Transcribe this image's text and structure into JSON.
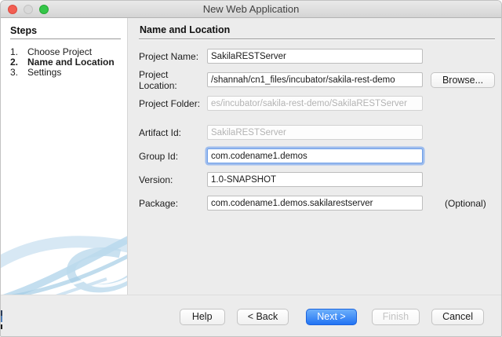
{
  "window": {
    "title": "New Web Application"
  },
  "steps": {
    "heading": "Steps",
    "items": [
      {
        "num": "1.",
        "label": "Choose Project"
      },
      {
        "num": "2.",
        "label": "Name and Location"
      },
      {
        "num": "3.",
        "label": "Settings"
      }
    ],
    "current_step": "Name and Location"
  },
  "main": {
    "heading": "Name and Location",
    "fields": {
      "project_name": {
        "label": "Project Name:",
        "value": "SakilaRESTServer"
      },
      "project_location": {
        "label": "Project Location:",
        "value": "/shannah/cn1_files/incubator/sakila-rest-demo"
      },
      "project_folder": {
        "label": "Project Folder:",
        "value": "es/incubator/sakila-rest-demo/SakilaRESTServer"
      },
      "artifact_id": {
        "label": "Artifact Id:",
        "value": "SakilaRESTServer"
      },
      "group_id": {
        "label": "Group Id:",
        "value": "com.codename1.demos"
      },
      "version": {
        "label": "Version:",
        "value": "1.0-SNAPSHOT"
      },
      "package": {
        "label": "Package:",
        "value": "com.codename1.demos.sakilarestserver",
        "hint": "(Optional)"
      }
    },
    "browse_label": "Browse..."
  },
  "footer": {
    "help_label": "Help",
    "back_label": "< Back",
    "next_label": "Next >",
    "finish_label": "Finish",
    "cancel_label": "Cancel"
  },
  "colors": {
    "accent_blue": "#2273f3",
    "swoosh_blue": "#bcd9ec",
    "panel_gray": "#ececec"
  }
}
